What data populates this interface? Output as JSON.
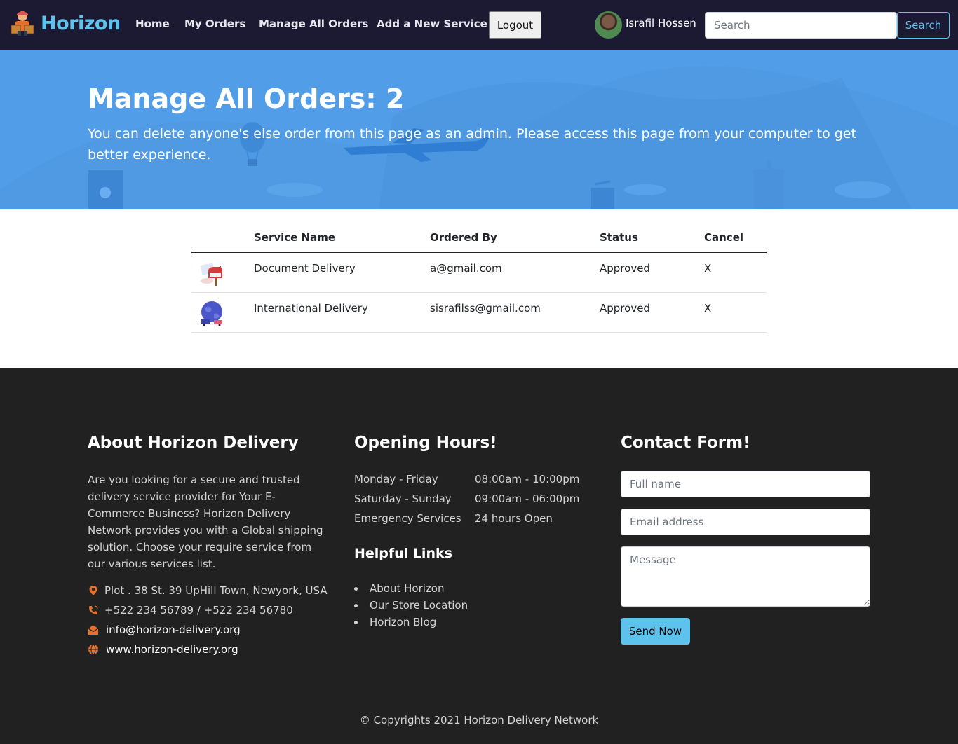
{
  "navbar": {
    "brand": "Horizon",
    "links": [
      {
        "label": "Home"
      },
      {
        "label": "My Orders"
      },
      {
        "label": "Manage All Orders"
      },
      {
        "label": "Add a New Service"
      }
    ],
    "logout_label": "Logout",
    "user_name": "Israfil Hossen",
    "search_placeholder": "Search",
    "search_button": "Search",
    "accent_color": "#5ec3ec",
    "background_color": "#1c1a33"
  },
  "hero": {
    "title": "Manage All Orders: 2",
    "subtitle": "You can delete anyone's else order from this page as an admin. Please access this page from your computer to get better experience.",
    "background_color": "#529de7"
  },
  "orders": {
    "headers": [
      "",
      "Service Name",
      "Ordered By",
      "Status",
      "Cancel"
    ],
    "rows": [
      {
        "image_icon": "mailbox-icon",
        "service": "Document Delivery",
        "ordered_by": "a@gmail.com",
        "status": "Approved",
        "cancel": "X"
      },
      {
        "image_icon": "globe-delivery-icon",
        "service": "International Delivery",
        "ordered_by": "sisrafilss@gmail.com",
        "status": "Approved",
        "cancel": "X"
      }
    ]
  },
  "footer": {
    "about": {
      "heading": "About Horizon Delivery",
      "text": "Are you looking for a secure and trusted delivery service provider for Your E-Commerce Business? Horizon Delivery Network provides you with a Global shipping solution. Choose your require service from our various services list.",
      "address": "Plot . 38 St. 39 UpHill Town, Newyork, USA",
      "phone": "+522 234 56789 / +522 234 56780",
      "email": "info@horizon-delivery.org",
      "website": "www.horizon-delivery.org",
      "icon_color": "#e8702a"
    },
    "hours": {
      "heading": "Opening Hours!",
      "rows": [
        {
          "day": "Monday - Friday",
          "time": "08:00am - 10:00pm"
        },
        {
          "day": "Saturday - Sunday",
          "time": "09:00am - 06:00pm"
        },
        {
          "day": "Emergency Services",
          "time": "24 hours Open"
        }
      ]
    },
    "links": {
      "heading": "Helpful Links",
      "items": [
        "About Horizon",
        "Our Store Location",
        "Horizon Blog"
      ]
    },
    "contact": {
      "heading": "Contact Form!",
      "name_placeholder": "Full name",
      "email_placeholder": "Email address",
      "message_placeholder": "Message",
      "send_label": "Send Now"
    },
    "copyright": "© Copyrights 2021 Horizon Delivery Network"
  }
}
